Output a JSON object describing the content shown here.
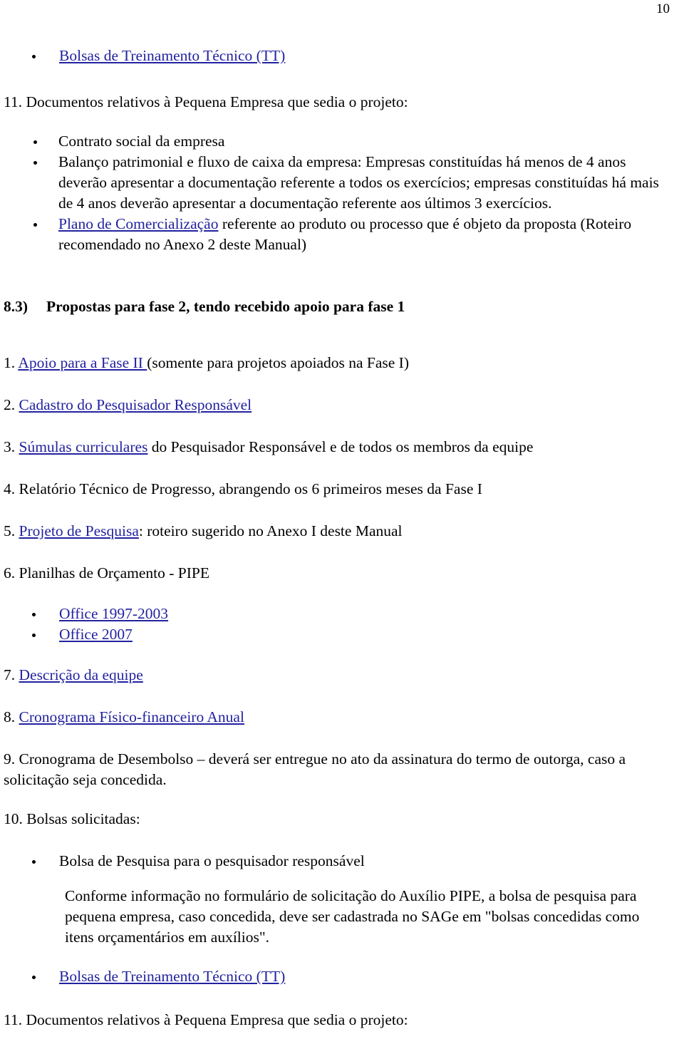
{
  "document": {
    "page_number": "10",
    "link_color": "#2222a0",
    "text_color": "#000000",
    "background_color": "#ffffff"
  },
  "blocks": {
    "top_bullet_tt": "Bolsas de Treinamento Técnico (TT)",
    "item11_top": "11. Documentos relativos à Pequena Empresa que sedia o projeto:",
    "bullet_contrato": "Contrato social da empresa",
    "bullet_balanco": "Balanço patrimonial e fluxo de caixa da empresa: Empresas constituídas há menos de 4 anos deverão apresentar a documentação referente a todos os exercícios; empresas constituídas há mais de 4 anos deverão apresentar a documentação referente aos últimos 3 exercícios.",
    "bullet_plano_link": "Plano de Comercialização",
    "bullet_plano_rest": " referente ao produto ou processo que é objeto da proposta (Roteiro recomendado no Anexo 2 deste Manual)",
    "section_number": "8.3)",
    "section_title": "Propostas para fase 2, tendo recebido apoio para fase 1",
    "item1_num": "1. ",
    "item1_link": "Apoio para a Fase II ",
    "item1_rest": "(somente para projetos apoiados na Fase I)",
    "item2_num": "2. ",
    "item2_link": "Cadastro do Pesquisador Responsável",
    "item2_rest": "",
    "item3_num": "3. ",
    "item3_link": "Súmulas curriculares",
    "item3_rest": " do Pesquisador Responsável e de todos os membros da equipe",
    "item4": "4. Relatório Técnico de Progresso, abrangendo os 6 primeiros meses da Fase I",
    "item5_num": "5. ",
    "item5_link": "Projeto de Pesquisa",
    "item5_rest": ": roteiro sugerido no Anexo I deste Manual",
    "item6": "6. Planilhas de Orçamento - PIPE",
    "bullet_office_1997": "Office 1997-2003",
    "bullet_office_2007": "Office 2007",
    "item7_num": "7. ",
    "item7_link": "Descrição da equipe",
    "item8_num": "8. ",
    "item8_link": "Cronograma Físico-financeiro Anual",
    "item9": "9. Cronograma de Desembolso – deverá ser entregue no ato da assinatura do termo de outorga, caso a solicitação seja concedida.",
    "item10": "10. Bolsas solicitadas:",
    "bullet_bolsa_pesquisa": "Bolsa de Pesquisa para o pesquisador responsável",
    "conforme_paragraph": "Conforme informação no formulário de solicitação do Auxílio PIPE, a bolsa de pesquisa para pequena empresa, caso concedida, deve ser cadastrada no SAGe em \"bolsas concedidas como itens orçamentários em auxílios\".",
    "bullet_tt_bottom": "Bolsas de Treinamento Técnico (TT)",
    "item11_bottom": "11. Documentos relativos à Pequena Empresa que sedia o projeto:"
  }
}
